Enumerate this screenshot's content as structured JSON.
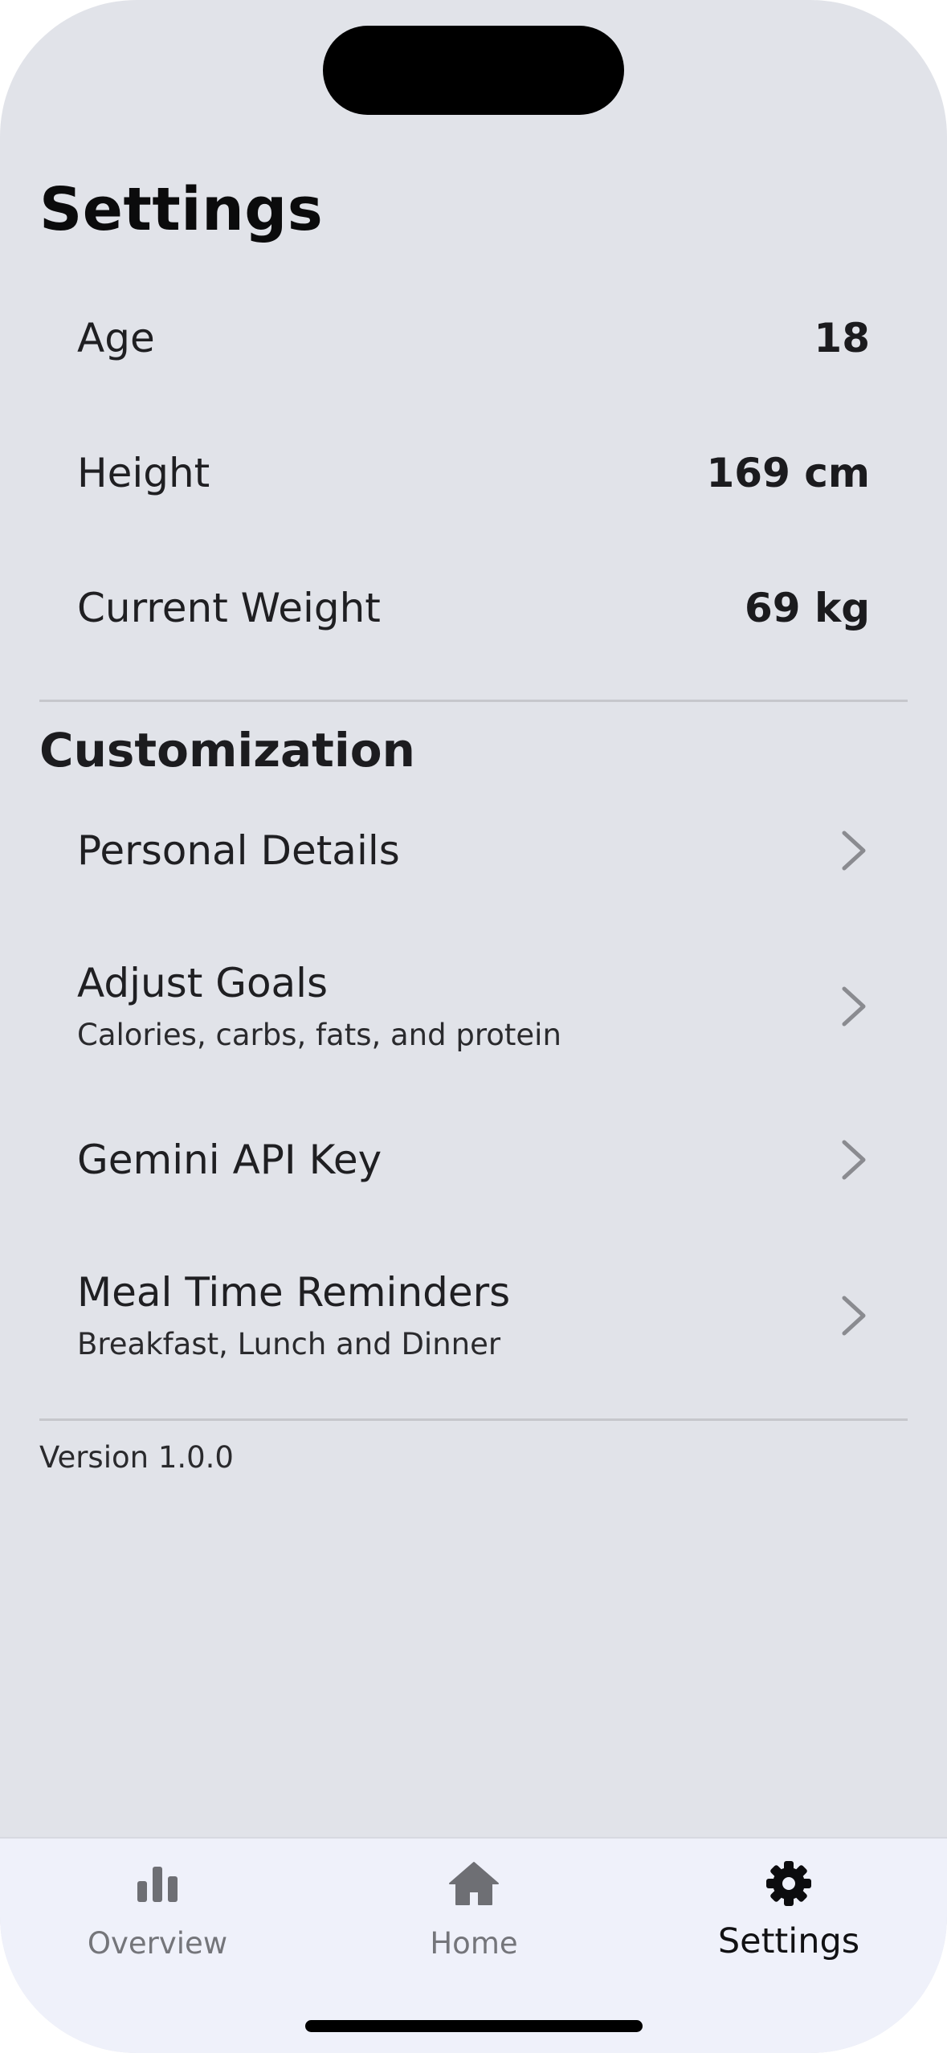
{
  "header": {
    "title": "Settings"
  },
  "profile": {
    "age": {
      "label": "Age",
      "value": "18"
    },
    "height": {
      "label": "Height",
      "value": "169 cm"
    },
    "weight": {
      "label": "Current Weight",
      "value": "69 kg"
    }
  },
  "customization": {
    "title": "Customization",
    "items": [
      {
        "label": "Personal Details",
        "subtitle": ""
      },
      {
        "label": "Adjust Goals",
        "subtitle": "Calories, carbs, fats, and protein"
      },
      {
        "label": "Gemini API Key",
        "subtitle": ""
      },
      {
        "label": "Meal Time Reminders",
        "subtitle": "Breakfast, Lunch and Dinner"
      }
    ]
  },
  "footer": {
    "version": "Version 1.0.0"
  },
  "tabbar": {
    "tabs": [
      {
        "label": "Overview",
        "icon": "bar-chart-icon",
        "active": false
      },
      {
        "label": "Home",
        "icon": "home-icon",
        "active": false
      },
      {
        "label": "Settings",
        "icon": "gear-icon",
        "active": true
      }
    ]
  },
  "colors": {
    "background": "#e1e3e9",
    "tabbar": "#eff1fa",
    "inactive_tab": "#74757a",
    "active_tab": "#111113",
    "chevron": "#8a8b90"
  }
}
